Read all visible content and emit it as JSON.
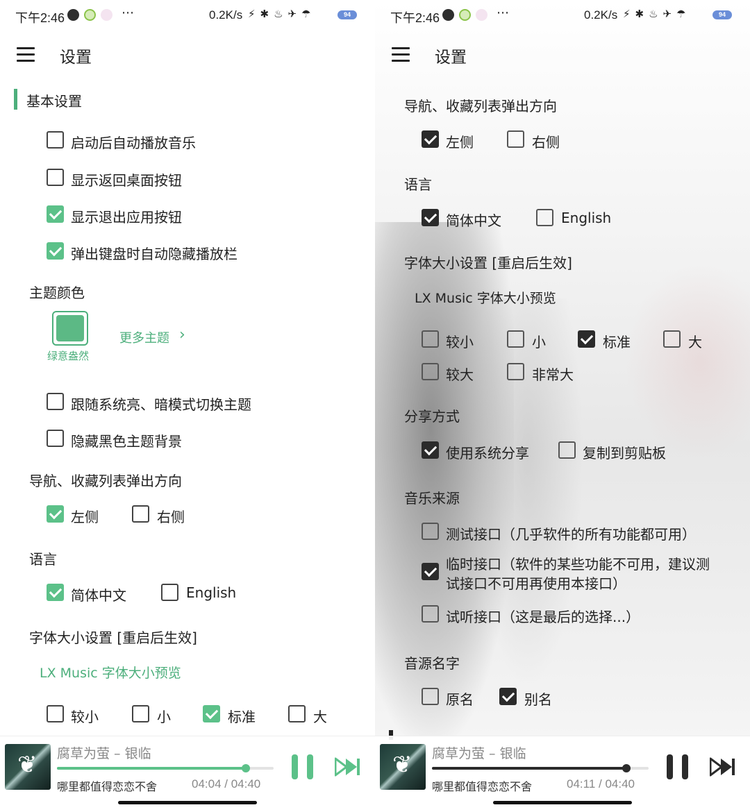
{
  "status_bar": {
    "time": "下午2:46",
    "net_speed": "0.2K/s",
    "status_icons": "⚡✱♨✈☂",
    "battery": "94"
  },
  "left": {
    "title": "设置",
    "accent_color": "#5cc189",
    "section_basic": "基本设置",
    "basic_items": [
      {
        "label": "启动后自动播放音乐",
        "checked": false
      },
      {
        "label": "显示返回桌面按钮",
        "checked": false
      },
      {
        "label": "显示退出应用按钮",
        "checked": true
      },
      {
        "label": "弹出键盘时自动隐藏播放栏",
        "checked": true
      }
    ],
    "theme_heading": "主题颜色",
    "theme_name": "绿意盎然",
    "more_themes": "更多主题",
    "theme_items": [
      {
        "label": "跟随系统亮、暗模式切换主题",
        "checked": false
      },
      {
        "label": "隐藏黑色主题背景",
        "checked": false
      }
    ],
    "nav_heading": "导航、收藏列表弹出方向",
    "nav_left": "左侧",
    "nav_right": "右侧",
    "lang_heading": "语言",
    "lang_zh": "简体中文",
    "lang_en": "English",
    "font_heading": "字体大小设置 [重启后生效]",
    "font_preview": "LX Music 字体大小预览",
    "font_sizes": [
      "较小",
      "小",
      "标准",
      "大"
    ]
  },
  "right": {
    "title": "设置",
    "nav_heading": "导航、收藏列表弹出方向",
    "nav_left": "左侧",
    "nav_right": "右侧",
    "lang_heading": "语言",
    "lang_zh": "简体中文",
    "lang_en": "English",
    "font_heading": "字体大小设置 [重启后生效]",
    "font_preview": "LX Music 字体大小预览",
    "font_sizes": [
      "较小",
      "小",
      "标准",
      "大",
      "较大",
      "非常大"
    ],
    "share_heading": "分享方式",
    "share_system": "使用系统分享",
    "share_clipboard": "复制到剪贴板",
    "source_heading": "音乐来源",
    "source_test": "测试接口（几乎软件的所有功能都可用）",
    "source_temp_line1": "临时接口（软件的某些功能不可用，建议测",
    "source_temp_line2": "试接口不可用再使用本接口）",
    "source_trial": "试听接口（这是最后的选择...）",
    "source_name_heading": "音源名字",
    "name_original": "原名",
    "name_alias": "别名"
  },
  "player_left": {
    "track": "腐草为萤 – 银临",
    "lyric": "哪里都值得恋恋不舍",
    "time": "04:04 / 04:40",
    "progress": 0.871,
    "color": "#5cc189"
  },
  "player_right": {
    "track": "腐草为萤 – 银临",
    "lyric": "哪里都值得恋恋不舍",
    "time": "04:11 / 04:40",
    "progress": 0.896,
    "color": "#2b2b2b"
  }
}
